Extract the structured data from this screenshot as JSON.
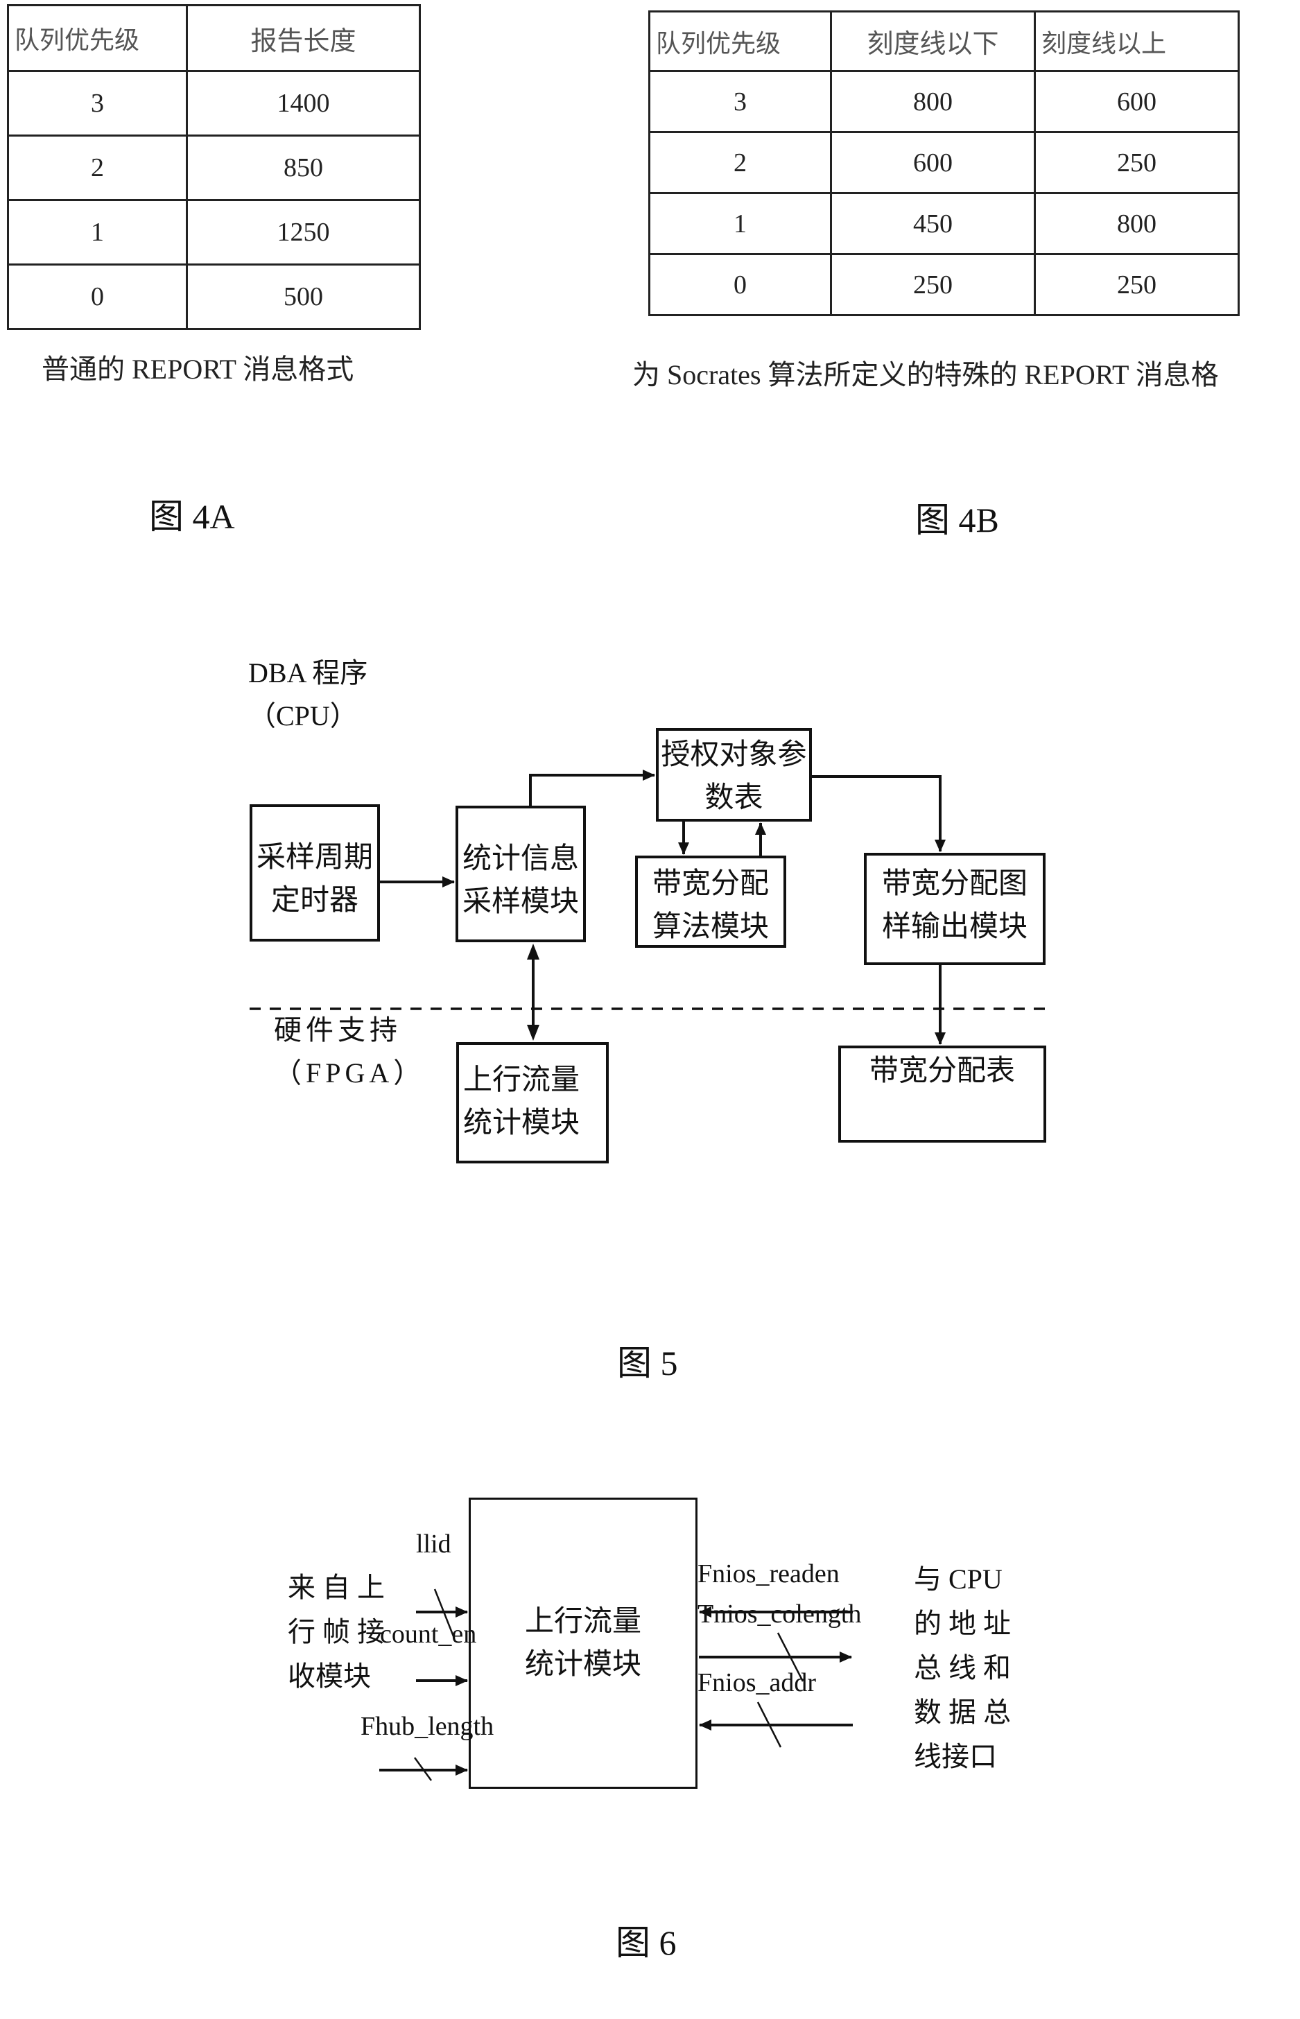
{
  "fig4a": {
    "headers": [
      "队列优先级",
      "报告长度"
    ],
    "rows": [
      [
        "3",
        "1400"
      ],
      [
        "2",
        "850"
      ],
      [
        "1",
        "1250"
      ],
      [
        "0",
        "500"
      ]
    ],
    "caption": "普通的 REPORT 消息格式",
    "label": "图 4A"
  },
  "fig4b": {
    "headers": [
      "队列优先级",
      "刻度线以下",
      "刻度线以上"
    ],
    "rows": [
      [
        "3",
        "800",
        "600"
      ],
      [
        "2",
        "600",
        "250"
      ],
      [
        "1",
        "450",
        "800"
      ],
      [
        "0",
        "250",
        "250"
      ]
    ],
    "caption": "为 Socrates 算法所定义的特殊的 REPORT 消息格",
    "label": "图 4B"
  },
  "fig5": {
    "cpu_label": "DBA 程序\n（CPU）",
    "hw_label": "硬件支持\n（FPGA）",
    "boxes": {
      "timer": "采样周期\n定时器",
      "stats_sampling": "统计信息\n采样模块",
      "grant_params": "授权对象参\n数表",
      "bw_algo": "带宽分配\n算法模块",
      "bw_map_output": "带宽分配图\n样输出模块",
      "upstream_stats": "上行流量\n统计模块",
      "bw_table": "带宽分配表"
    },
    "label": "图 5"
  },
  "fig6": {
    "left_label": "来 自 上\n行 帧 接\n收模块",
    "module": "上行流量\n统计模块",
    "inputs": [
      "llid",
      "count_en",
      "Fhub_length"
    ],
    "cpu_signals": [
      "Fnios_readen",
      "Tnios_colength",
      "Fnios_addr"
    ],
    "right_label": "与 CPU\n的 地 址\n总 线 和\n数 据 总\n线接口",
    "label": "图 6"
  }
}
